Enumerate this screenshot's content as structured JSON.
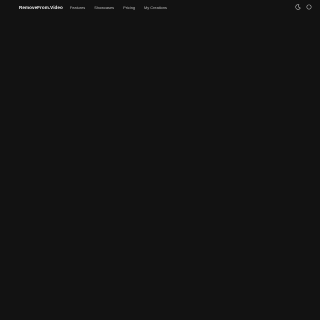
{
  "header": {
    "brand": "RemoveFrom.Video",
    "nav": [
      {
        "label": "Features"
      },
      {
        "label": "Showcases"
      },
      {
        "label": "Pricing"
      },
      {
        "label": "My Creations"
      }
    ],
    "icons": [
      "theme-toggle-icon",
      "account-icon"
    ]
  },
  "colors": {
    "background": "#121212",
    "brand_text": "#f2f2f2",
    "nav_text": "#bdbdbd"
  }
}
